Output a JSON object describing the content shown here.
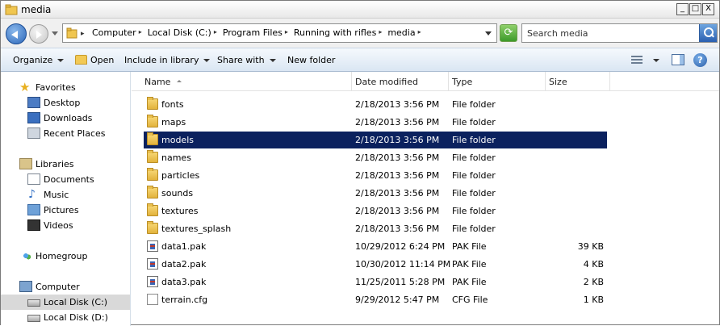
{
  "window": {
    "title": "media",
    "controls": {
      "minimize": "_",
      "maximize": "□",
      "close": "X"
    }
  },
  "address": {
    "crumbs": [
      "Computer",
      "Local Disk (C:)",
      "Program Files",
      "Running with rifles",
      "media"
    ],
    "search_placeholder": "Search media"
  },
  "commands": {
    "organize": "Organize",
    "open": "Open",
    "include_in_library": "Include in library",
    "share_with": "Share with",
    "new_folder": "New folder"
  },
  "nav": {
    "favorites": "Favorites",
    "desktop": "Desktop",
    "downloads": "Downloads",
    "recent_places": "Recent Places",
    "libraries": "Libraries",
    "documents": "Documents",
    "music": "Music",
    "pictures": "Pictures",
    "videos": "Videos",
    "homegroup": "Homegroup",
    "computer": "Computer",
    "local_disk_c": "Local Disk (C:)",
    "local_disk_d": "Local Disk (D:)"
  },
  "columns": {
    "name": "Name",
    "date": "Date modified",
    "type": "Type",
    "size": "Size"
  },
  "files": [
    {
      "name": "fonts",
      "date": "2/18/2013 3:56 PM",
      "type": "File folder",
      "size": ""
    },
    {
      "name": "maps",
      "date": "2/18/2013 3:56 PM",
      "type": "File folder",
      "size": ""
    },
    {
      "name": "models",
      "date": "2/18/2013 3:56 PM",
      "type": "File folder",
      "size": ""
    },
    {
      "name": "names",
      "date": "2/18/2013 3:56 PM",
      "type": "File folder",
      "size": ""
    },
    {
      "name": "particles",
      "date": "2/18/2013 3:56 PM",
      "type": "File folder",
      "size": ""
    },
    {
      "name": "sounds",
      "date": "2/18/2013 3:56 PM",
      "type": "File folder",
      "size": ""
    },
    {
      "name": "textures",
      "date": "2/18/2013 3:56 PM",
      "type": "File folder",
      "size": ""
    },
    {
      "name": "textures_splash",
      "date": "2/18/2013 3:56 PM",
      "type": "File folder",
      "size": ""
    },
    {
      "name": "data1.pak",
      "date": "10/29/2012 6:24 PM",
      "type": "PAK File",
      "size": "39 KB"
    },
    {
      "name": "data2.pak",
      "date": "10/30/2012 11:14 PM",
      "type": "PAK File",
      "size": "4 KB"
    },
    {
      "name": "data3.pak",
      "date": "11/25/2011 5:28 PM",
      "type": "PAK File",
      "size": "2 KB"
    },
    {
      "name": "terrain.cfg",
      "date": "9/29/2012 5:47 PM",
      "type": "CFG File",
      "size": "1 KB"
    }
  ],
  "colors": {
    "selection": "#0b215e",
    "accent": "#2b66b8"
  }
}
